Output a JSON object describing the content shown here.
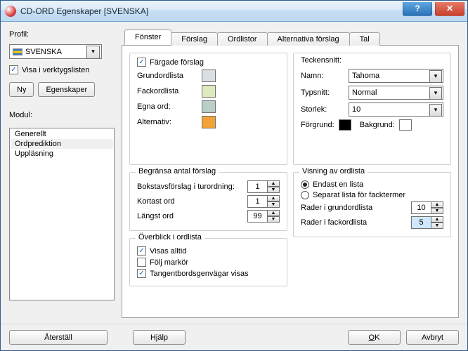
{
  "window": {
    "title": "CD-ORD Egenskaper [SVENSKA]"
  },
  "left": {
    "profil_label": "Profil:",
    "profile": "SVENSKA",
    "show_toolbar": "Visa i verktygslisten",
    "ny": "Ny",
    "egenskaper": "Egenskaper",
    "modul_label": "Modul:",
    "items": [
      "Generellt",
      "Ordprediktion",
      "Uppläsning"
    ],
    "selected": 1
  },
  "tabs": [
    "Fönster",
    "Förslag",
    "Ordlistor",
    "Alternativa förslag",
    "Tal"
  ],
  "tab_active": 0,
  "pane": {
    "colored": "Färgade förslag",
    "rows": [
      {
        "label": "Grundordlista",
        "color": "#d9e0e2"
      },
      {
        "label": "Fackordlista",
        "color": "#dfe9c0"
      },
      {
        "label": "Egna ord:",
        "color": "#b9cec9"
      },
      {
        "label": "Alternativ:",
        "color": "#f3a23a"
      }
    ],
    "font": {
      "heading": "Teckensnitt:",
      "name_label": "Namn:",
      "name": "Tahoma",
      "style_label": "Typsnitt:",
      "style": "Normal",
      "size_label": "Storlek:",
      "size": "10",
      "fg_label": "Förgrund:",
      "fg": "#000000",
      "bg_label": "Bakgrund:",
      "bg": "#ffffff"
    },
    "limit": {
      "heading": "Begränsa antal förslag",
      "letters_label": "Bokstavsförslag i turordning:",
      "letters": "1",
      "short_label": "Kortast ord",
      "short": "1",
      "long_label": "Längst ord",
      "long": "99"
    },
    "overview": {
      "heading": "Överblick i ordlista",
      "always": "Visas alltid",
      "follow": "Följ markör",
      "shortcuts": "Tangentbordsgenvägar visas"
    },
    "display": {
      "heading": "Visning av ordlista",
      "opt1": "Endast en lista",
      "opt2": "Separat lista för facktermer",
      "rows1_label": "Rader i grundordlista",
      "rows1": "10",
      "rows2_label": "Rader i fackordlista",
      "rows2": "5"
    }
  },
  "footer": {
    "reset": "Återställ",
    "help": "Hjälp",
    "ok": "OK",
    "cancel": "Avbryt"
  }
}
